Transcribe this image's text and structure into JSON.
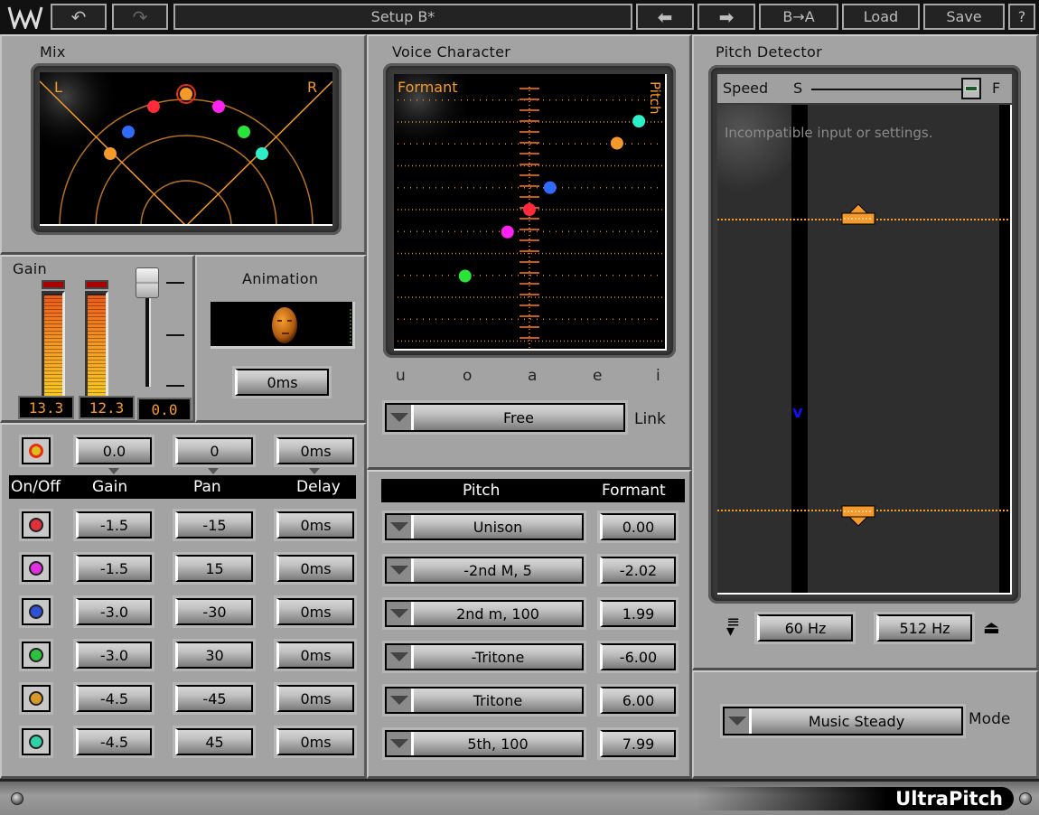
{
  "toolbar": {
    "logo_icon": "waves-logo-icon",
    "undo_icon": "undo-icon",
    "redo_icon": "redo-icon",
    "preset_name": "Setup B*",
    "prev_icon": "arrow-left-icon",
    "next_icon": "arrow-right-icon",
    "compare_label": "B→A",
    "load_label": "Load",
    "save_label": "Save",
    "help_label": "?"
  },
  "mix": {
    "title": "Mix",
    "left_label": "L",
    "right_label": "R",
    "voice_colors": [
      "#f59a2a",
      "#ff2a3a",
      "#ff22f0",
      "#2f6bff",
      "#29e53a",
      "#f59a2a",
      "#2ef0c8"
    ],
    "line_color": "#f59a2a"
  },
  "gain": {
    "title": "Gain",
    "meter_left": "13.3",
    "meter_right": "12.3",
    "fader_value": "0.0",
    "meter_left_level": 0.98,
    "meter_right_level": 0.98,
    "fader_level": 1.0
  },
  "animation": {
    "title": "Animation",
    "delay_value": "0ms",
    "face_icon": "face-animation-icon"
  },
  "master_row": {
    "led_color": "#d8c020",
    "gain": "0.0",
    "pan": "0",
    "delay": "0ms"
  },
  "voice_table": {
    "headers": [
      "On/Off",
      "Gain",
      "Pan",
      "Delay"
    ],
    "rows": [
      {
        "led_color": "#e0303a",
        "gain": "-1.5",
        "pan": "-15",
        "delay": "0ms"
      },
      {
        "led_color": "#e030e0",
        "gain": "-1.5",
        "pan": "15",
        "delay": "0ms"
      },
      {
        "led_color": "#3050d8",
        "gain": "-3.0",
        "pan": "-30",
        "delay": "0ms"
      },
      {
        "led_color": "#30c040",
        "gain": "-3.0",
        "pan": "30",
        "delay": "0ms"
      },
      {
        "led_color": "#d8982a",
        "gain": "-4.5",
        "pan": "-45",
        "delay": "0ms"
      },
      {
        "led_color": "#30d0a8",
        "gain": "-4.5",
        "pan": "45",
        "delay": "0ms"
      }
    ]
  },
  "voice_character": {
    "title": "Voice Character",
    "formant_label": "Formant",
    "pitch_label": "Pitch",
    "vowels": [
      "u",
      "o",
      "a",
      "e",
      "i"
    ],
    "link_value": "Free",
    "link_label": "Link",
    "points": [
      {
        "color": "#2ef0c8",
        "formant": 0.85,
        "pitch": 7.99
      },
      {
        "color": "#f59a2a",
        "formant": 0.68,
        "pitch": 6.0
      },
      {
        "color": "#2f6bff",
        "formant": 0.16,
        "pitch": 1.99
      },
      {
        "color": "#ff2a3a",
        "formant": 0.0,
        "pitch": 0.0
      },
      {
        "color": "#ff22f0",
        "formant": -0.17,
        "pitch": -2.02
      },
      {
        "color": "#29e53a",
        "formant": -0.5,
        "pitch": -6.0
      }
    ]
  },
  "pitch_table": {
    "headers": [
      "Pitch",
      "Formant"
    ],
    "rows": [
      {
        "pitch": "Unison",
        "formant": "0.00"
      },
      {
        "pitch": "-2nd M, 5",
        "formant": "-2.02"
      },
      {
        "pitch": "2nd m, 100",
        "formant": "1.99"
      },
      {
        "pitch": "-Tritone",
        "formant": "-6.00"
      },
      {
        "pitch": "Tritone",
        "formant": "6.00"
      },
      {
        "pitch": "5th, 100",
        "formant": "7.99"
      }
    ]
  },
  "pitch_detector": {
    "title": "Pitch Detector",
    "speed_label": "Speed",
    "speed_slow": "S",
    "speed_fast": "F",
    "speed_level": 1.0,
    "message": "Incompatible input or settings.",
    "low_freq": "60 Hz",
    "high_freq": "512 Hz",
    "low_icon": "lower-limit-icon",
    "high_icon": "upper-limit-icon"
  },
  "mode": {
    "value": "Music Steady",
    "label": "Mode"
  },
  "footer": {
    "brand": "UltraPitch"
  }
}
